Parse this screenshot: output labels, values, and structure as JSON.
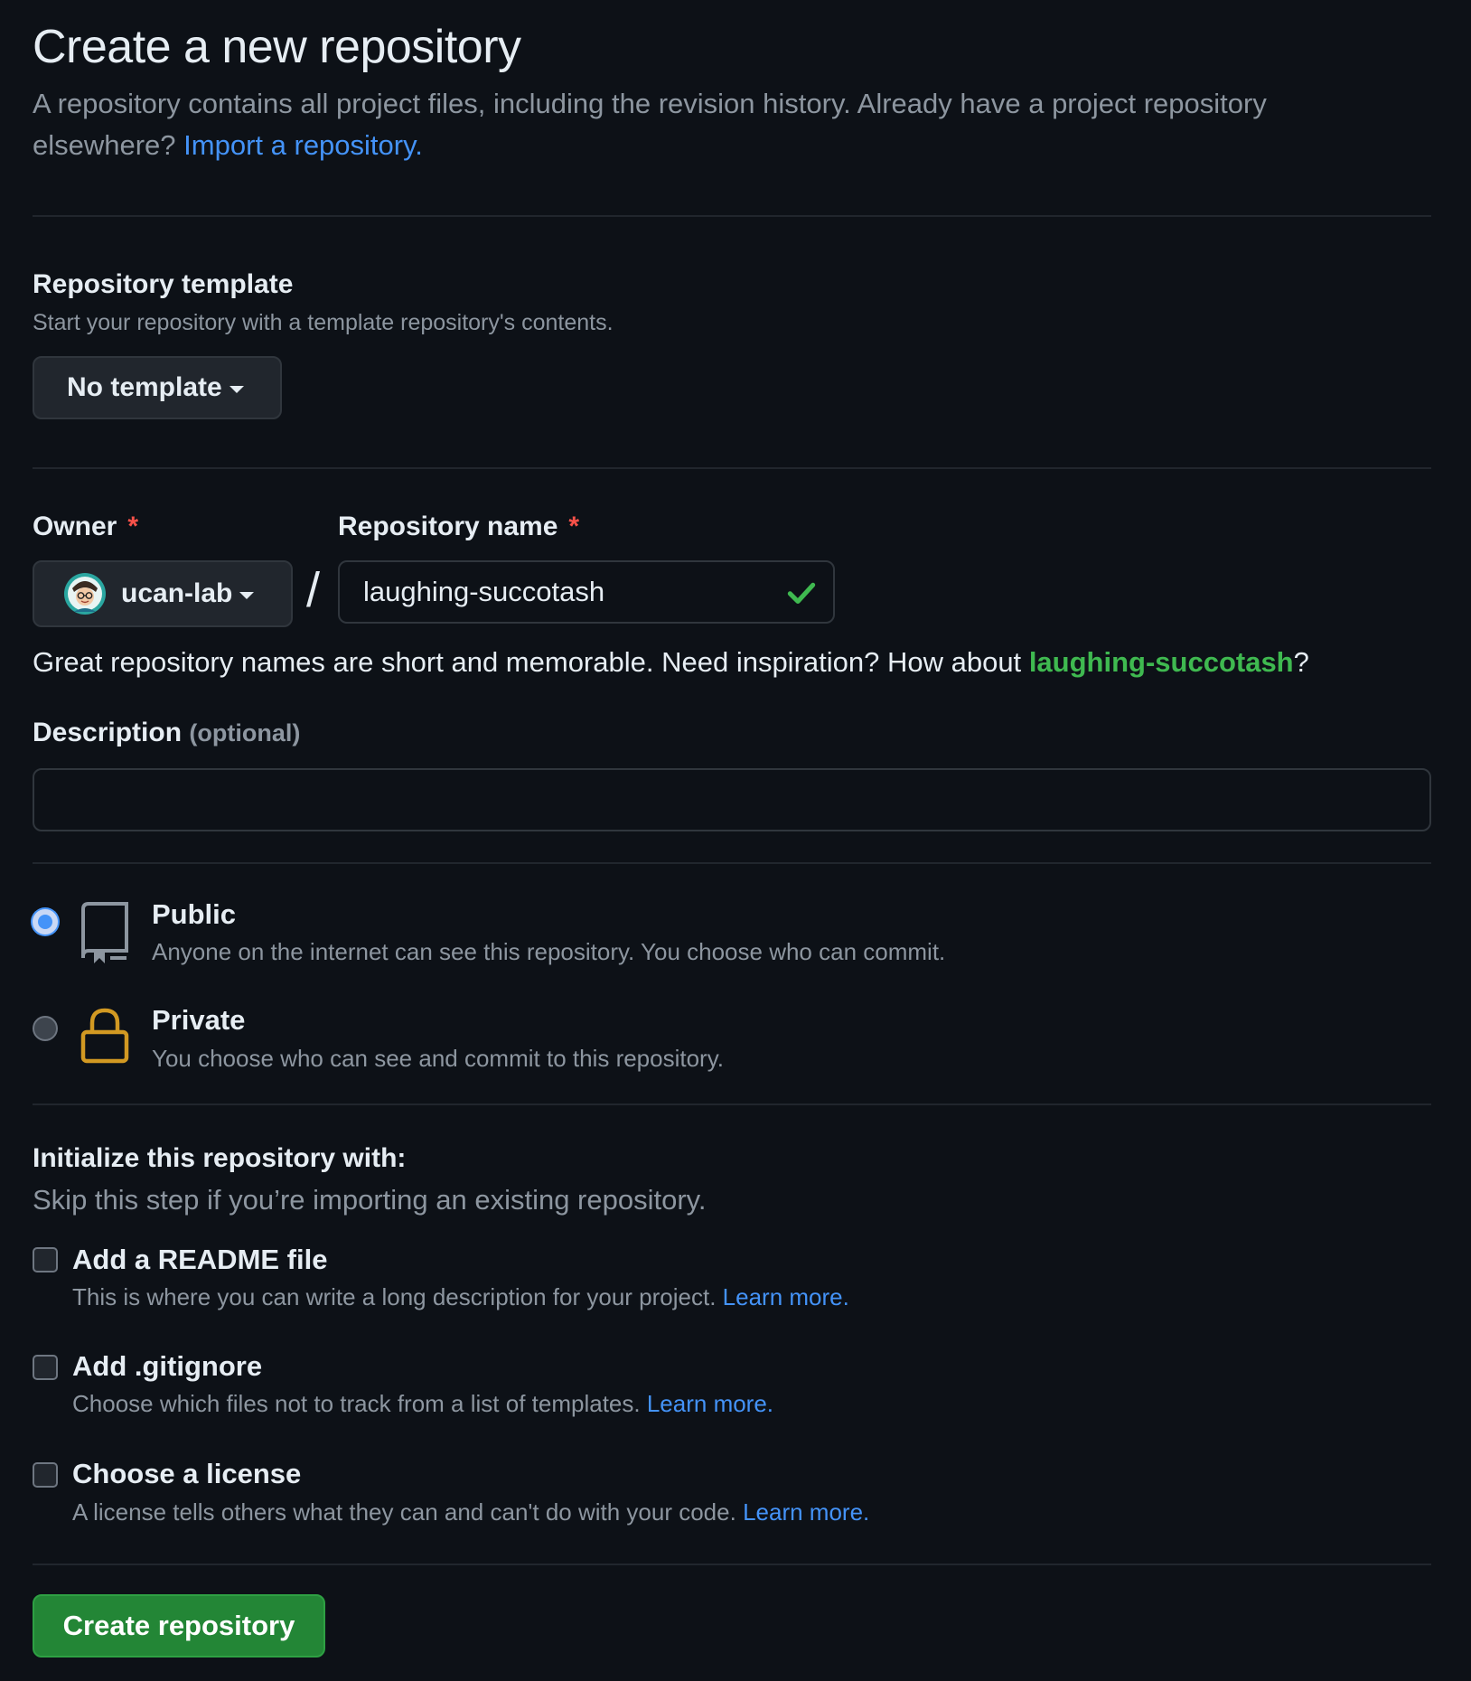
{
  "header": {
    "title": "Create a new repository",
    "intro": "A repository contains all project files, including the revision history. Already have a project repository elsewhere?",
    "import_link": "Import a repository."
  },
  "template": {
    "title": "Repository template",
    "subtitle": "Start your repository with a template repository's contents.",
    "dropdown_label": "No template"
  },
  "owner": {
    "label": "Owner",
    "required_mark": "*",
    "value": "ucan-lab"
  },
  "repo_name": {
    "label": "Repository name",
    "required_mark": "*",
    "value": "laughing-succotash",
    "separator": "/"
  },
  "hint": {
    "text": "Great repository names are short and memorable. Need inspiration? How about",
    "suggestion": "laughing-succotash",
    "end": "?"
  },
  "description": {
    "label": "Description",
    "optional": "(optional)",
    "value": "",
    "placeholder": ""
  },
  "visibility": {
    "selected": "public",
    "public": {
      "title": "Public",
      "subtitle": "Anyone on the internet can see this repository. You choose who can commit."
    },
    "private": {
      "title": "Private",
      "subtitle": "You choose who can see and commit to this repository."
    }
  },
  "init": {
    "title": "Initialize this repository with:",
    "subtitle": "Skip this step if you’re importing an existing repository.",
    "options": [
      {
        "title": "Add a README file",
        "subtitle": "This is where you can write a long description for your project.",
        "link": "Learn more.",
        "checked": false
      },
      {
        "title": "Add .gitignore",
        "subtitle": "Choose which files not to track from a list of templates.",
        "link": "Learn more.",
        "checked": false
      },
      {
        "title": "Choose a license",
        "subtitle": "A license tells others what they can and can't do with your code.",
        "link": "Learn more.",
        "checked": false
      }
    ]
  },
  "submit": {
    "label": "Create repository"
  },
  "colors": {
    "background": "#0d1117",
    "accent_link": "#4493f8",
    "success": "#3fb950",
    "primary_button": "#238636",
    "required": "#f85149",
    "lock_icon": "#d29922"
  }
}
